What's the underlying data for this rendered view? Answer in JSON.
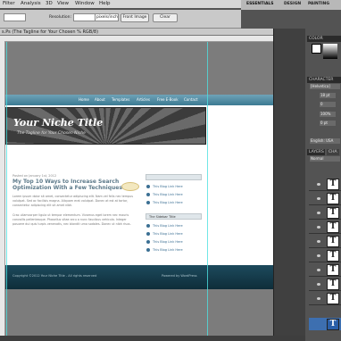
{
  "menubar": {
    "items": [
      "Filter",
      "Analysis",
      "3D",
      "View",
      "Window",
      "Help"
    ]
  },
  "workspace": {
    "items": [
      "ESSENTIALS",
      "DESIGN",
      "PAINTING"
    ]
  },
  "options": {
    "resolution_label": "Resolution:",
    "resolution_unit": "pixels/inch",
    "front_image": "Front Image",
    "clear": "Clear"
  },
  "document": {
    "tab_title": "s.Ps (The Tagline for Your Chosen % RGB/8)"
  },
  "site": {
    "nav": [
      "Home",
      "About",
      "Templates",
      "Articles",
      "Free E-Book",
      "Contact"
    ],
    "title": "Your Niche Title",
    "tagline": "The Tagline for Your Chosen Niche",
    "post_meta": "Posted on January 1st, 2012",
    "post_title": "My Top 10 Ways to Increase Search Optimization With a Few Techniques",
    "para1": "Lorem ipsum dolor sit amet, consectetur adipiscing elit. Nam vel felis nec tempus volutpat. Sed ac facilisis magna. Aliquam erat volutpat. Donec at est at tortor, consectetur adipiscing elit sit amet nibh.",
    "para2": "Cras ullamcorper ligula ut tempor elementum. Vivamus eget lorem nec mauris convallis pellentesque. Phasellus vitae arcu a nunc faucibus vehicula. Integer posuere dui quis turpis venenatis, nec blandit urna sodales. Donec ut nibh risus.",
    "sidebar_head1": "",
    "sidebar_head2": "The Sidebar Title",
    "link": "This Blog Link Here",
    "footer_left": "Copyright ©2012 Your Niche Title - All rights reserved",
    "footer_right": "Powered by WordPress"
  },
  "panels": {
    "color_tab": "COLOR",
    "character_tab": "CHARACTER",
    "font_family": "[Helvetica]",
    "font_size": "18 pt",
    "kerning": "0",
    "scale": "100%",
    "baseline": "0 pt",
    "language": "English: USA",
    "layers_tab": "LAYERS",
    "channels_tab": "CHA",
    "blend_mode": "Normal"
  },
  "colors": {
    "accent": "#4de0e0",
    "nav": "#3c7a92",
    "footer": "#0e2d3a"
  }
}
